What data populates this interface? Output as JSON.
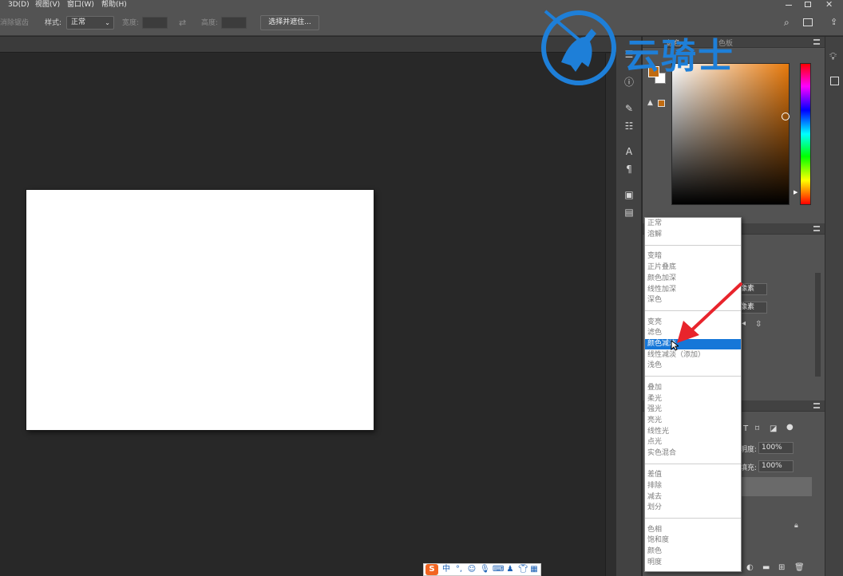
{
  "menubar": {
    "items": [
      "3D(D)",
      "视图(V)",
      "窗口(W)",
      "帮助(H)"
    ]
  },
  "options": {
    "antialias_label": "消除锯齿",
    "style_label": "样式:",
    "style_value": "正常",
    "width_label": "宽度:",
    "height_label": "高度:",
    "select_mask_button": "选择并遮住..."
  },
  "color_panel": {
    "tab_label": "颜色",
    "swatches_label": "色板",
    "fg_color": "#c06b11",
    "bg_color": "#ffffff",
    "hue_gradient": "orange"
  },
  "properties_panel": {
    "units_a": "像素",
    "units_b": "像素"
  },
  "layers_panel": {
    "opacity_label": "明度:",
    "opacity_value": "100%",
    "fill_label": "填充:",
    "fill_value": "100%"
  },
  "blend_menu": {
    "groups": [
      [
        "正常",
        "溶解"
      ],
      [
        "变暗",
        "正片叠底",
        "颜色加深",
        "线性加深",
        "深色"
      ],
      [
        "变亮",
        "滤色",
        "颜色减淡",
        "线性减淡（添加）",
        "浅色"
      ],
      [
        "叠加",
        "柔光",
        "强光",
        "亮光",
        "线性光",
        "点光",
        "实色混合"
      ],
      [
        "差值",
        "排除",
        "减去",
        "划分"
      ],
      [
        "色相",
        "饱和度",
        "颜色",
        "明度"
      ]
    ],
    "selected": "颜色减淡"
  },
  "watermark": {
    "text": "云骑士",
    "color": "#1e7fd8"
  },
  "annotation": {
    "arrow_color": "#e8242c"
  },
  "ime_toolbar": {
    "lang": "中",
    "logo": "S"
  },
  "icons": {
    "strip": [
      "history-icon",
      "info-icon",
      "brush-icon",
      "adjust-icon",
      "character-icon",
      "paragraph-icon",
      "image-icon",
      "notes-icon"
    ],
    "right": [
      "bulb-icon",
      "export-icon"
    ],
    "top_right": [
      "search-icon",
      "layout-icon",
      "share-icon"
    ]
  }
}
